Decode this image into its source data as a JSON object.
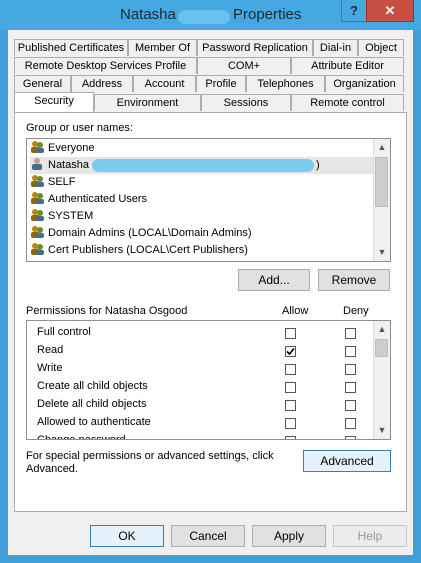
{
  "window": {
    "title_name": "Natasha",
    "title_suffix": "Properties",
    "help": "?",
    "close": "✕"
  },
  "tabs": {
    "row1": [
      "Published Certificates",
      "Member Of",
      "Password Replication",
      "Dial-in",
      "Object"
    ],
    "row2": [
      "Remote Desktop Services Profile",
      "COM+",
      "Attribute Editor"
    ],
    "row3": [
      "General",
      "Address",
      "Account",
      "Profile",
      "Telephones",
      "Organization"
    ],
    "row4": [
      "Security",
      "Environment",
      "Sessions",
      "Remote control"
    ]
  },
  "group_section": {
    "label": "Group or user names:",
    "items": [
      "Everyone",
      "Natasha",
      "SELF",
      "Authenticated Users",
      "SYSTEM",
      "Domain Admins (LOCAL\\Domain Admins)",
      "Cert Publishers (LOCAL\\Cert Publishers)"
    ],
    "natasha_suffix": ")",
    "selected_index": 1,
    "add_button": "Add...",
    "remove_button": "Remove"
  },
  "permissions": {
    "label": "Permissions for Natasha Osgood",
    "allow_header": "Allow",
    "deny_header": "Deny",
    "rows": [
      {
        "name": "Full control",
        "allow": false,
        "deny": false
      },
      {
        "name": "Read",
        "allow": true,
        "deny": false
      },
      {
        "name": "Write",
        "allow": false,
        "deny": false
      },
      {
        "name": "Create all child objects",
        "allow": false,
        "deny": false
      },
      {
        "name": "Delete all child objects",
        "allow": false,
        "deny": false
      },
      {
        "name": "Allowed to authenticate",
        "allow": false,
        "deny": false
      },
      {
        "name": "Change password",
        "allow": false,
        "deny": false
      }
    ]
  },
  "advanced": {
    "text": "For special permissions or advanced settings, click Advanced.",
    "button": "Advanced"
  },
  "footer": {
    "ok": "OK",
    "cancel": "Cancel",
    "apply": "Apply",
    "help": "Help"
  },
  "colors": {
    "titlebar": "#45a8e0",
    "close": "#c74f41",
    "dialog": "#f0f0f0",
    "check": "#000000"
  },
  "icons": {
    "user_group": "users-icon",
    "user": "user-icon",
    "check": "checkmark"
  }
}
